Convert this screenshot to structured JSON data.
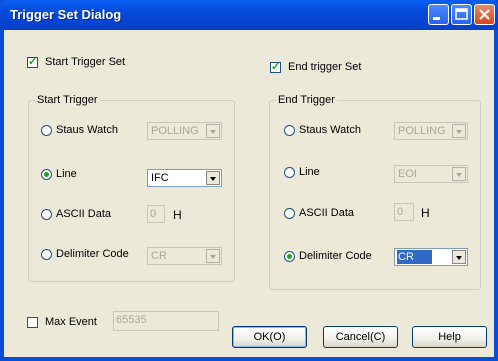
{
  "window": {
    "title": "Trigger Set Dialog",
    "controls": [
      "minimize-icon",
      "maximize-icon",
      "close-icon"
    ]
  },
  "start_trigger_set": {
    "label": "Start Trigger Set",
    "checked": true
  },
  "end_trigger_set": {
    "label": "End trigger Set",
    "checked": true
  },
  "start_trigger": {
    "group_label": "Start Trigger",
    "status_watch": {
      "label": "Staus Watch",
      "value": "POLLING",
      "selected": false
    },
    "line": {
      "label": "Line",
      "value": "IFC",
      "selected": true
    },
    "ascii_data": {
      "label": "ASCII Data",
      "value": "0",
      "suffix": "H",
      "selected": false
    },
    "delimiter_code": {
      "label": "Delimiter Code",
      "value": "CR",
      "selected": false
    }
  },
  "end_trigger": {
    "group_label": "End Trigger",
    "status_watch": {
      "label": "Staus Watch",
      "value": "POLLING",
      "selected": false
    },
    "line": {
      "label": "Line",
      "value": "EOI",
      "selected": false
    },
    "ascii_data": {
      "label": "ASCII Data",
      "value": "0",
      "suffix": "H",
      "selected": false
    },
    "delimiter_code": {
      "label": "Delimiter Code",
      "value": "CR",
      "selected": true
    }
  },
  "max_event": {
    "label": "Max Event",
    "value": "65535",
    "checked": false
  },
  "buttons": {
    "ok": "OK(O)",
    "cancel": "Cancel(C)",
    "help": "Help"
  }
}
